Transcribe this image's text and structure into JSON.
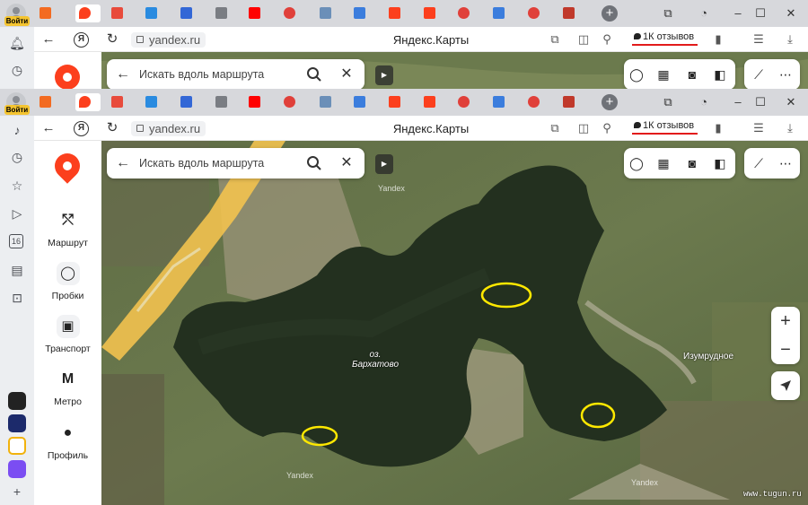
{
  "browser": {
    "login_badge": "Войти",
    "domain": "yandex.ru",
    "page_title": "Яндекс.Карты",
    "reviews_label": "1К отзывов",
    "yandex_logo": "Я",
    "tabs": [
      {
        "icon": "avatar-icon",
        "color": "#c7c9cd"
      },
      {
        "icon": "zen-icon",
        "color": "#f36b21"
      },
      {
        "icon": "maps-pin-icon",
        "color": "#fc3f1d"
      },
      {
        "icon": "thermometer-icon",
        "color": "#e84b3c"
      },
      {
        "icon": "mail-at-icon",
        "color": "#2a8be0"
      },
      {
        "icon": "photo-icon",
        "color": "#3367d6"
      },
      {
        "icon": "document-icon",
        "color": "#7a7d83"
      },
      {
        "icon": "youtube-icon",
        "color": "#ff0000"
      },
      {
        "icon": "pokeball-icon",
        "color": "#e0403a"
      },
      {
        "icon": "feather-icon",
        "color": "#6b8fb8"
      },
      {
        "icon": "k-icon",
        "color": "#3b7ddd"
      },
      {
        "icon": "yandex-icon",
        "color": "#fc3f1d"
      },
      {
        "icon": "yandex-icon",
        "color": "#fc3f1d"
      },
      {
        "icon": "circle-icon",
        "color": "#e0403a"
      },
      {
        "icon": "flag-icon",
        "color": "#3b7ddd"
      },
      {
        "icon": "pokeball-icon",
        "color": "#e0403a"
      },
      {
        "icon": "card-icon",
        "color": "#c0392b"
      }
    ]
  },
  "sidebar": {
    "items": [
      {
        "label": "Маршрут",
        "icon": "route-icon",
        "glyph": "⤲"
      },
      {
        "label": "Пробки",
        "icon": "traffic-icon",
        "glyph": "◯"
      },
      {
        "label": "Транспорт",
        "icon": "bus-icon",
        "glyph": "▣"
      },
      {
        "label": "Метро",
        "icon": "metro-icon",
        "glyph": "М"
      },
      {
        "label": "Профиль",
        "icon": "profile-icon",
        "glyph": "●"
      }
    ]
  },
  "search": {
    "placeholder": "Искать вдоль маршрута"
  },
  "map": {
    "lake_label_prefix": "оз.",
    "lake_label_name": "Бархатово",
    "village_label": "Изумрудное",
    "watermark_label": "Yandex",
    "site_watermark": "www.tugun.ru",
    "highlight_color": "#ffe800",
    "zoom_in": "+",
    "zoom_out": "−"
  },
  "colors": {
    "brand": "#fc3f1d",
    "water": "#23301f",
    "land": "#5d6a44",
    "road": "#f2c24f"
  }
}
